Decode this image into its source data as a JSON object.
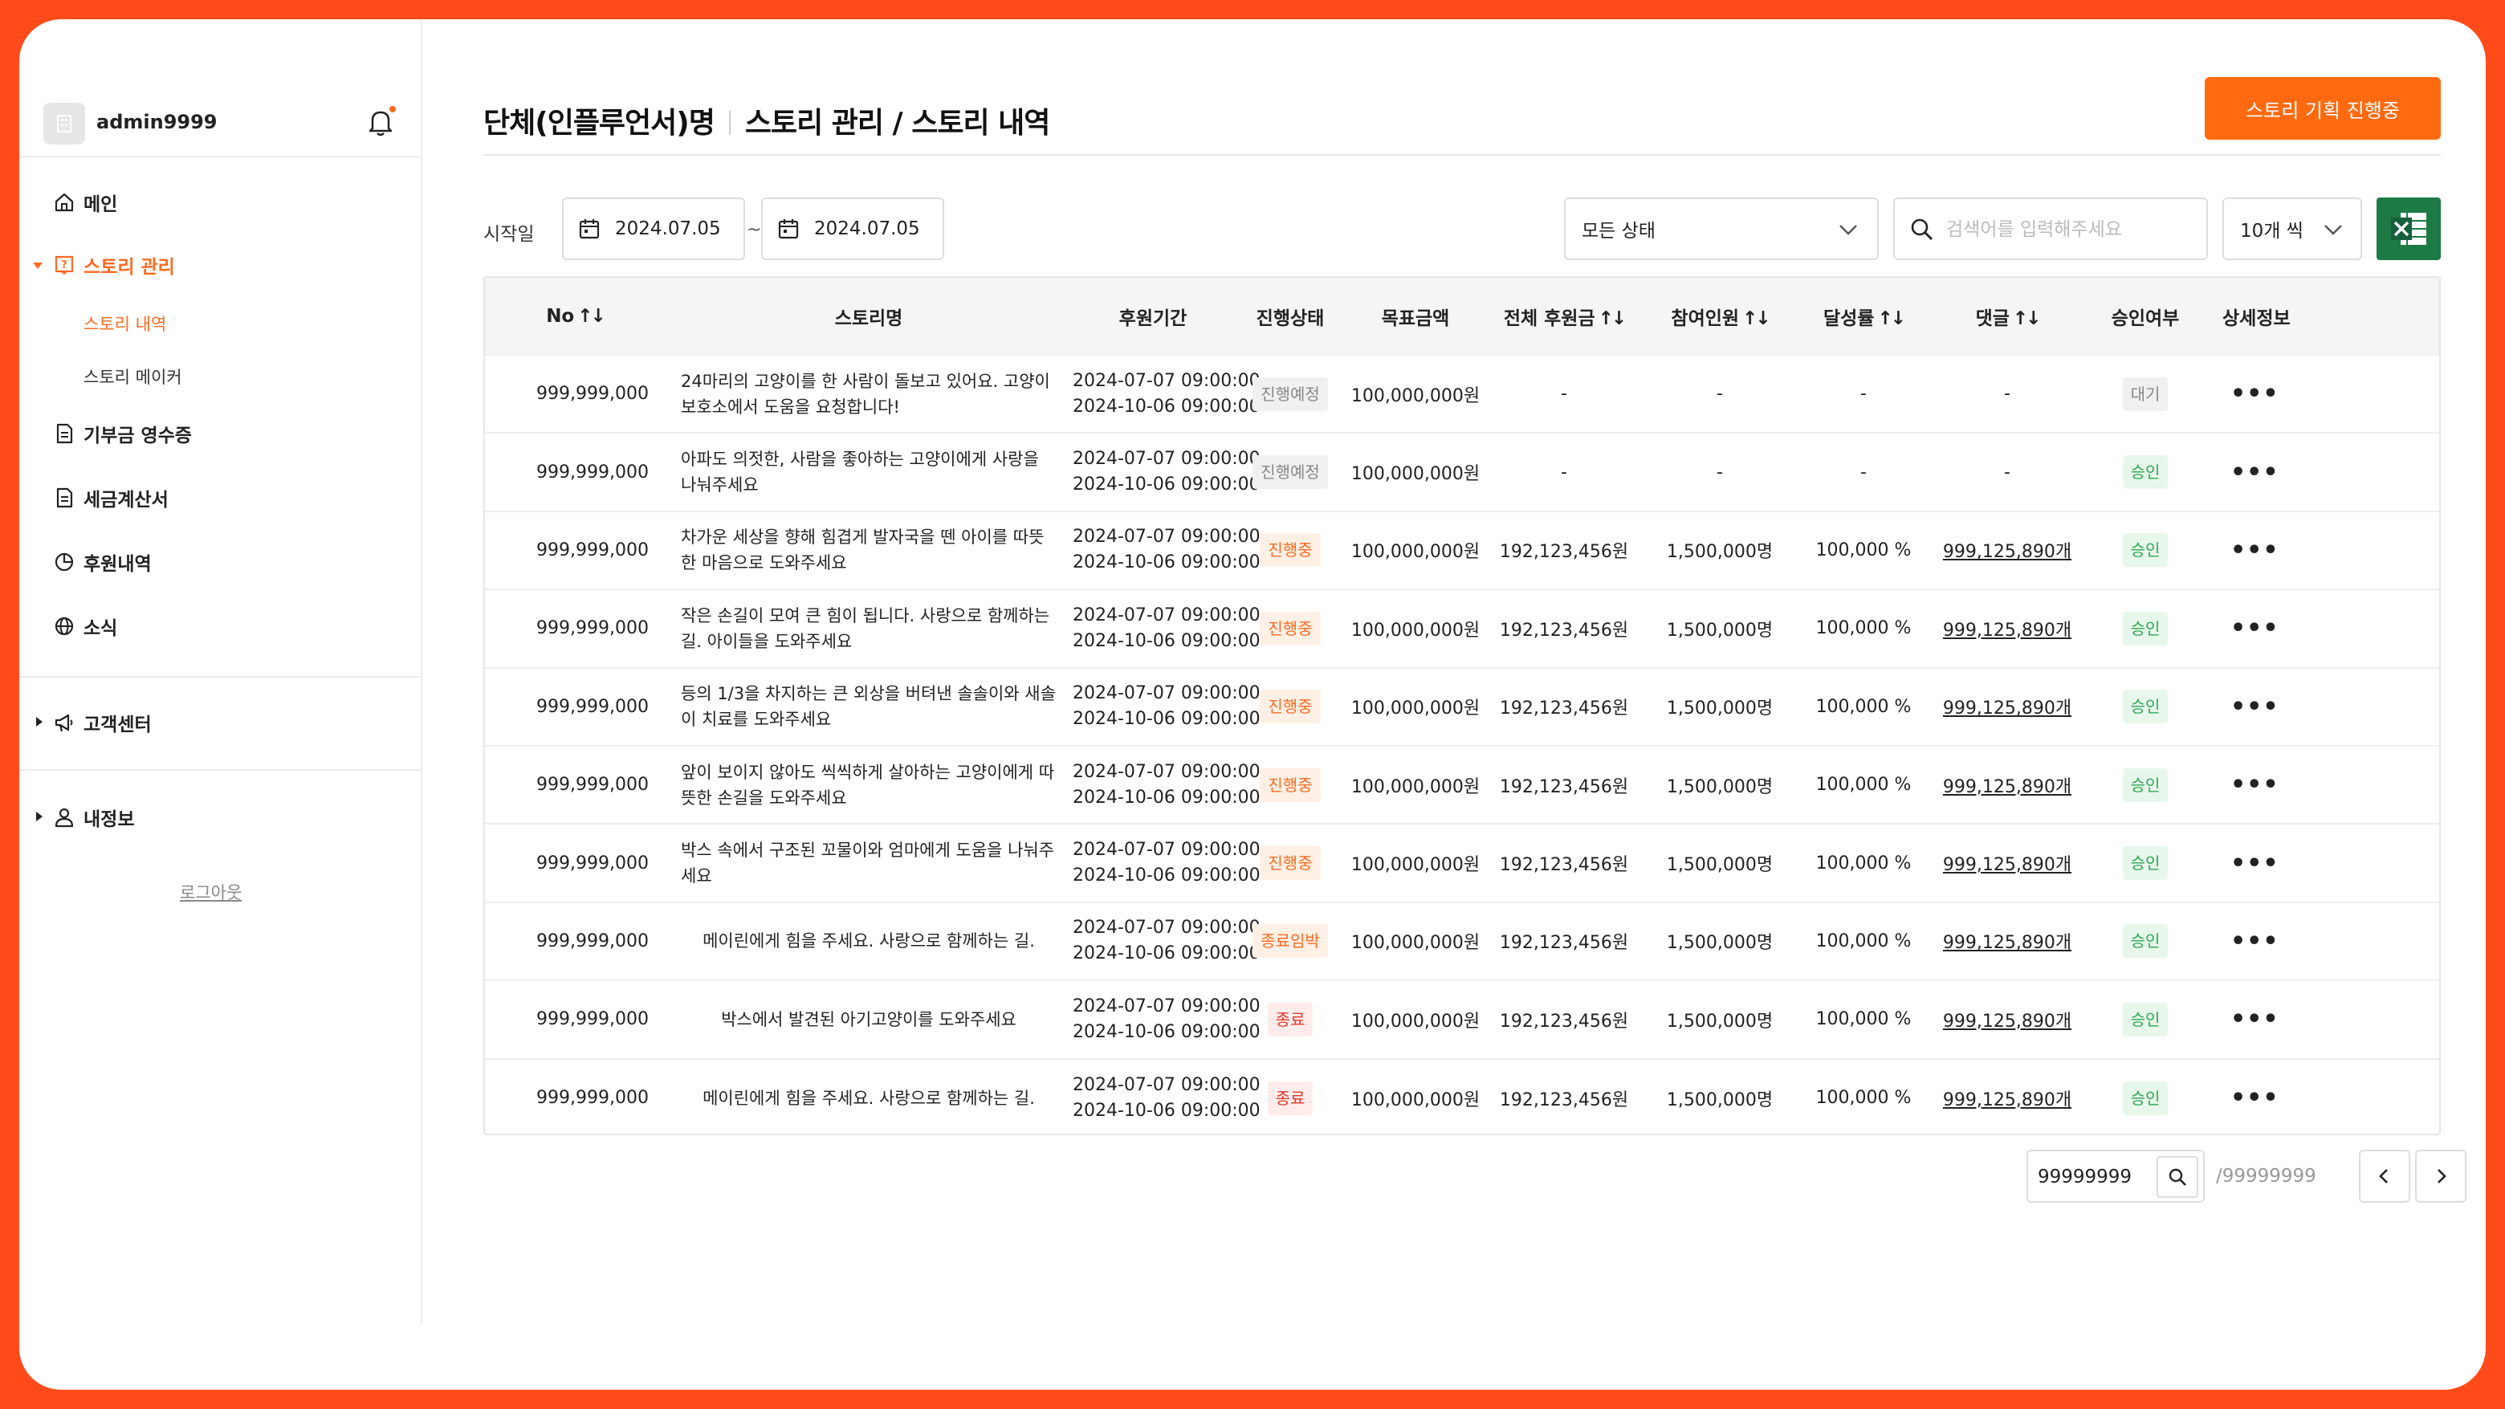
{
  "sidebar": {
    "username": "admin9999",
    "menu": [
      {
        "label": "메인"
      },
      {
        "label": "스토리 관리"
      },
      {
        "label": "스토리 내역"
      },
      {
        "label": "스토리 메이커"
      },
      {
        "label": "기부금 영수증"
      },
      {
        "label": "세금계산서"
      },
      {
        "label": "후원내역"
      },
      {
        "label": "소식"
      },
      {
        "label": "고객센터"
      },
      {
        "label": "내정보"
      }
    ],
    "logout": "로그아웃"
  },
  "header": {
    "org_name": "단체(인플루언서)명",
    "breadcrumb": "스토리 관리 / 스토리 내역",
    "primary_button": "스토리 기획 진행중"
  },
  "filters": {
    "start_label": "시작일",
    "date_from": "2024.07.05",
    "tilde": "~",
    "date_to": "2024.07.05",
    "status": "모든 상태",
    "search_placeholder": "검색어를 입력해주세요",
    "page_size": "10개 씩"
  },
  "table": {
    "headers": {
      "no": "No",
      "title": "스토리명",
      "period": "후원기간",
      "status": "진행상태",
      "goal": "목표금액",
      "total": "전체 후원금",
      "participants": "참여인원",
      "rate": "달성률",
      "comments": "댓글",
      "approval": "승인여부",
      "detail": "상세정보"
    },
    "sort_icon": "↑↓",
    "rows": [
      {
        "no": "999,999,000",
        "title": "24마리의 고양이를 한 사람이 돌보고 있어요. 고양이 보호소에서 도움을 요청합니다!",
        "start": "2024-07-07 09:00:00",
        "end": "2024-10-06 09:00:00",
        "status": "진행예정",
        "goal": "100,000,000원",
        "total": "-",
        "participants": "-",
        "rate": "-",
        "comments": "-",
        "approval": "대기"
      },
      {
        "no": "999,999,000",
        "title": "아파도 의젓한, 사람을 좋아하는 고양이에게 사랑을 나눠주세요",
        "start": "2024-07-07 09:00:00",
        "end": "2024-10-06 09:00:00",
        "status": "진행예정",
        "goal": "100,000,000원",
        "total": "-",
        "participants": "-",
        "rate": "-",
        "comments": "-",
        "approval": "승인"
      },
      {
        "no": "999,999,000",
        "title": "차가운 세상을 향해 힘겹게 발자국을 뗀 아이를 따뜻한 마음으로 도와주세요",
        "start": "2024-07-07 09:00:00",
        "end": "2024-10-06 09:00:00",
        "status": "진행중",
        "goal": "100,000,000원",
        "total": "192,123,456원",
        "participants": "1,500,000명",
        "rate": "100,000 %",
        "comments": "999,125,890개",
        "approval": "승인"
      },
      {
        "no": "999,999,000",
        "title": "작은 손길이 모여 큰 힘이 됩니다. 사랑으로 함께하는 길. 아이들을 도와주세요",
        "start": "2024-07-07 09:00:00",
        "end": "2024-10-06 09:00:00",
        "status": "진행중",
        "goal": "100,000,000원",
        "total": "192,123,456원",
        "participants": "1,500,000명",
        "rate": "100,000 %",
        "comments": "999,125,890개",
        "approval": "승인"
      },
      {
        "no": "999,999,000",
        "title": "등의 1/3을 차지하는 큰 외상을 버텨낸 솔솔이와 새솔이 치료를 도와주세요",
        "start": "2024-07-07 09:00:00",
        "end": "2024-10-06 09:00:00",
        "status": "진행중",
        "goal": "100,000,000원",
        "total": "192,123,456원",
        "participants": "1,500,000명",
        "rate": "100,000 %",
        "comments": "999,125,890개",
        "approval": "승인"
      },
      {
        "no": "999,999,000",
        "title": "앞이 보이지 않아도 씩씩하게 살아하는 고양이에게 따뜻한 손길을 도와주세요",
        "start": "2024-07-07 09:00:00",
        "end": "2024-10-06 09:00:00",
        "status": "진행중",
        "goal": "100,000,000원",
        "total": "192,123,456원",
        "participants": "1,500,000명",
        "rate": "100,000 %",
        "comments": "999,125,890개",
        "approval": "승인"
      },
      {
        "no": "999,999,000",
        "title": "박스 속에서 구조된 꼬물이와 엄마에게 도움을 나눠주세요",
        "start": "2024-07-07 09:00:00",
        "end": "2024-10-06 09:00:00",
        "status": "진행중",
        "goal": "100,000,000원",
        "total": "192,123,456원",
        "participants": "1,500,000명",
        "rate": "100,000 %",
        "comments": "999,125,890개",
        "approval": "승인"
      },
      {
        "no": "999,999,000",
        "title": "메이린에게 힘을 주세요. 사랑으로 함께하는 길.",
        "start": "2024-07-07 09:00:00",
        "end": "2024-10-06 09:00:00",
        "status": "종료임박",
        "goal": "100,000,000원",
        "total": "192,123,456원",
        "participants": "1,500,000명",
        "rate": "100,000 %",
        "comments": "999,125,890개",
        "approval": "승인"
      },
      {
        "no": "999,999,000",
        "title": "박스에서 발견된 아기고양이를 도와주세요",
        "start": "2024-07-07 09:00:00",
        "end": "2024-10-06 09:00:00",
        "status": "종료",
        "goal": "100,000,000원",
        "total": "192,123,456원",
        "participants": "1,500,000명",
        "rate": "100,000 %",
        "comments": "999,125,890개",
        "approval": "승인"
      },
      {
        "no": "999,999,000",
        "title": "메이린에게 힘을 주세요. 사랑으로 함께하는 길.",
        "start": "2024-07-07 09:00:00",
        "end": "2024-10-06 09:00:00",
        "status": "종료",
        "goal": "100,000,000원",
        "total": "192,123,456원",
        "participants": "1,500,000명",
        "rate": "100,000 %",
        "comments": "999,125,890개",
        "approval": "승인"
      }
    ],
    "more_label": "•••"
  },
  "pagination": {
    "current": "99999999",
    "total": "/99999999"
  },
  "colors": {
    "accent": "#ff6a10",
    "frame": "#ff4a1a",
    "excel": "#1d7a45",
    "approved": "#2aaa4f"
  }
}
